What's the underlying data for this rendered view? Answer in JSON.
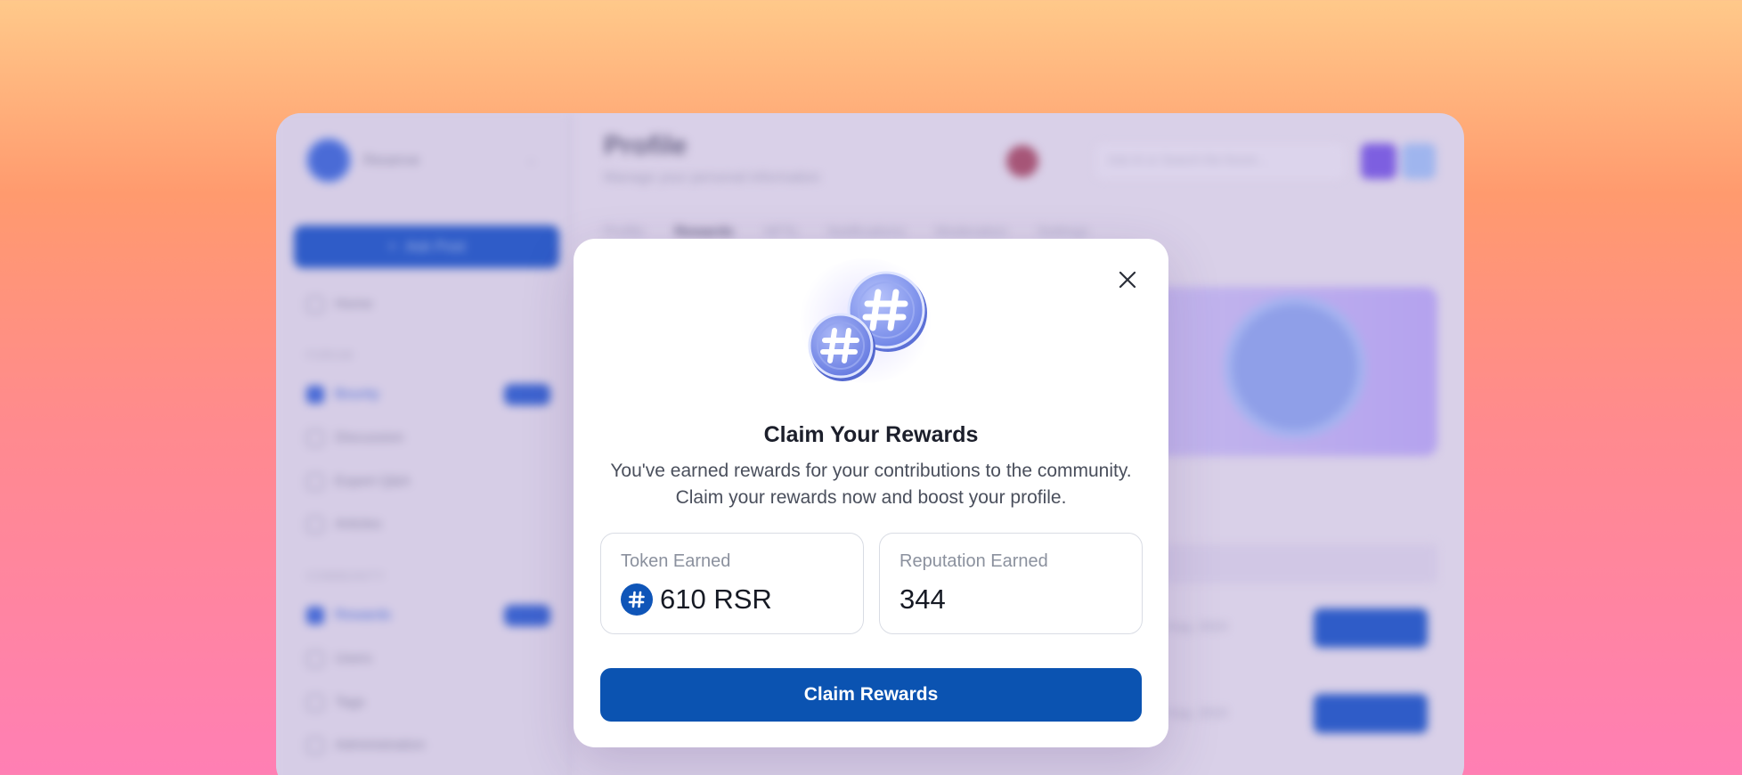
{
  "background_app": {
    "brand_name": "Reserve",
    "ask_button_label": "Ask Post",
    "sections": [
      "FORUM",
      "COMMUNITY"
    ],
    "nav_items": [
      "Home",
      "Bounty",
      "Discussion",
      "Expert Q&A",
      "Articles",
      "Rewards",
      "Users",
      "Tags",
      "Administration"
    ],
    "page_title": "Profile",
    "page_subtitle": "Manage your personal information",
    "search_placeholder": "Ask AI or Search the forum...",
    "tabs": [
      "Profile",
      "Rewards",
      "NFTs",
      "Notifications",
      "Moderation",
      "Settings"
    ],
    "row_texts": [
      "Aug, 2024",
      "Aug, 2024"
    ],
    "row_button_label": "Claim"
  },
  "modal": {
    "title": "Claim Your Rewards",
    "description": "You've earned rewards for your contributions to the community. Claim your rewards now and boost your profile.",
    "token_card": {
      "label": "Token Earned",
      "value": "610 RSR",
      "icon": "hashtag-coin-icon"
    },
    "reputation_card": {
      "label": "Reputation Earned",
      "value": "344"
    },
    "claim_button_label": "Claim Rewards",
    "close_icon": "close-icon",
    "illustration": "hashtag-coins-illustration"
  },
  "colors": {
    "primary": "#0b53b1",
    "token_icon": "#0f55b8",
    "coin": "#7f95ee"
  }
}
